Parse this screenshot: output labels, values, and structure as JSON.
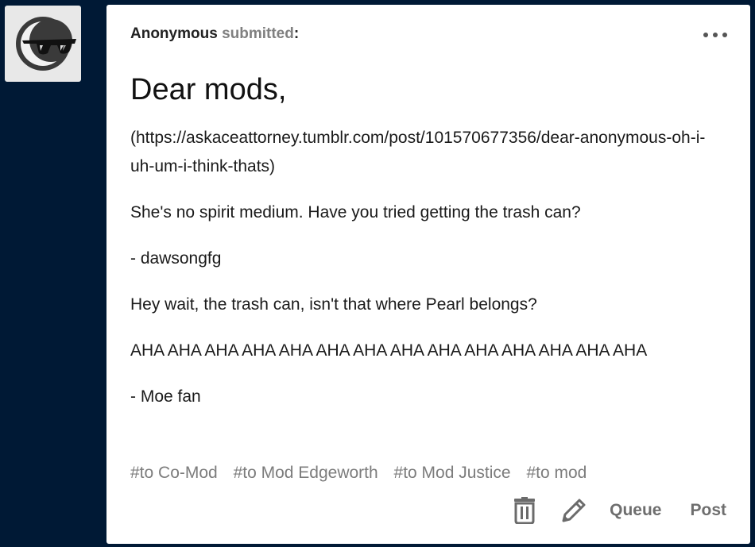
{
  "post": {
    "author": "Anonymous",
    "action": "submitted",
    "colon": ":",
    "title": "Dear mods,",
    "paragraphs": [
      "(https://askaceattorney.tumblr.com/post/101570677356/dear-anonymous-oh-i-uh-um-i-think-thats)",
      "She's no spirit medium. Have you tried getting the trash can?",
      "- dawsongfg",
      "Hey wait, the trash can, isn't that where Pearl belongs?",
      "AHA AHA AHA AHA AHA AHA AHA AHA AHA AHA AHA AHA AHA AHA",
      "- Moe fan"
    ],
    "tags": [
      "#to Co-Mod",
      "#to Mod Edgeworth",
      "#to Mod Justice",
      "#to mod"
    ]
  },
  "actions": {
    "queue_label": "Queue",
    "post_label": "Post",
    "delete_icon": "trash-icon",
    "edit_icon": "pencil-icon",
    "more_icon": "more-dots-icon"
  },
  "colors": {
    "background": "#001935",
    "card": "#ffffff",
    "tag_text": "#7c7c7c"
  }
}
